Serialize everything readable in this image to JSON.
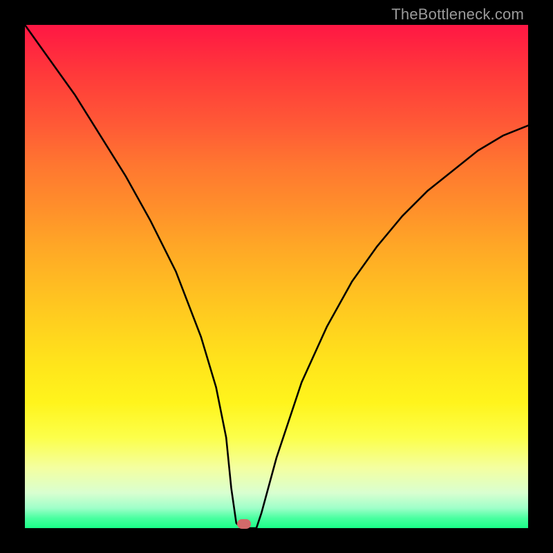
{
  "watermark": "TheBottleneck.com",
  "chart_data": {
    "type": "line",
    "title": "",
    "xlabel": "",
    "ylabel": "",
    "xlim": [
      0,
      100
    ],
    "ylim": [
      0,
      100
    ],
    "grid": false,
    "series": [
      {
        "name": "curve",
        "x": [
          0,
          5,
          10,
          15,
          20,
          25,
          30,
          35,
          38,
          40,
          41,
          42,
          43,
          44,
          45,
          46,
          47,
          50,
          55,
          60,
          65,
          70,
          75,
          80,
          85,
          90,
          95,
          100
        ],
        "values": [
          100,
          93,
          86,
          78,
          70,
          61,
          51,
          38,
          28,
          18,
          8,
          1,
          0,
          0,
          0,
          0,
          3,
          14,
          29,
          40,
          49,
          56,
          62,
          67,
          71,
          75,
          78,
          80
        ]
      }
    ],
    "marker": {
      "x": 43.5,
      "y": 0.8
    },
    "colors": {
      "background_top": "#ff1744",
      "background_bottom": "#19ff88",
      "curve": "#000000",
      "marker": "#d26a6a",
      "frame": "#000000"
    }
  }
}
